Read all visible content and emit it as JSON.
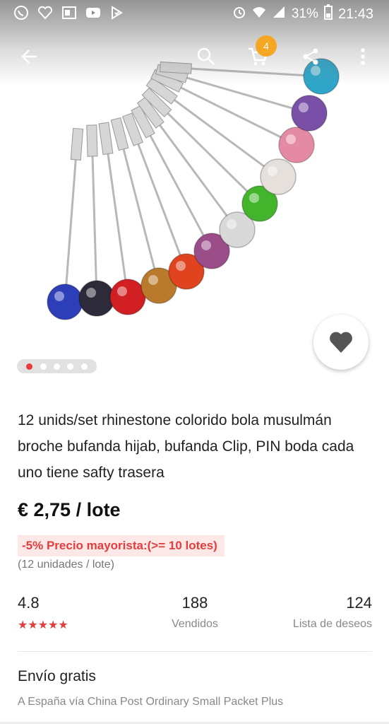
{
  "status_bar": {
    "battery": "31%",
    "time": "21:43",
    "left_icons": [
      "whatsapp-icon",
      "heart-app-icon",
      "office-icon",
      "youtube-icon",
      "download-check-icon"
    ],
    "right_icons": [
      "alarm-icon",
      "wifi-icon",
      "signal-icon",
      "battery-icon"
    ]
  },
  "toolbar": {
    "icons": [
      "back-arrow-icon",
      "search-icon",
      "cart-icon",
      "share-icon",
      "more-vert-icon"
    ],
    "cart_count": "4"
  },
  "carousel": {
    "total": 5,
    "active": 0
  },
  "product": {
    "title": "12 unids/set rhinestone colorido bola musulmán broche bufanda hijab, bufanda Clip, PIN boda cada uno tiene safty trasera",
    "price": "€ 2,75 / lote",
    "promo": "-5% Precio mayorista:(>= 10 lotes)",
    "unit": "(12 unidades / lote)"
  },
  "stats": {
    "rating_value": "4.8",
    "rating_stars": "★★★★★",
    "sold_value": "188",
    "sold_label": "Vendidos",
    "wishlist_value": "124",
    "wishlist_label": "Lista de deseos"
  },
  "shipping": {
    "title": "Envío gratis",
    "desc": "A España vía China Post Ordinary Small Packet Plus"
  },
  "colors": {
    "accent_red": "#e43d3d",
    "badge_orange": "#f5a623",
    "ball_colors": [
      "#2c3fb8",
      "#2d2a3a",
      "#d21f24",
      "#b97a2c",
      "#e0441f",
      "#9b4d8a",
      "#d9d9d9",
      "#43b52c",
      "#e6e0dc",
      "#e58aa4",
      "#7a4fa8",
      "#2fa6c9"
    ]
  }
}
